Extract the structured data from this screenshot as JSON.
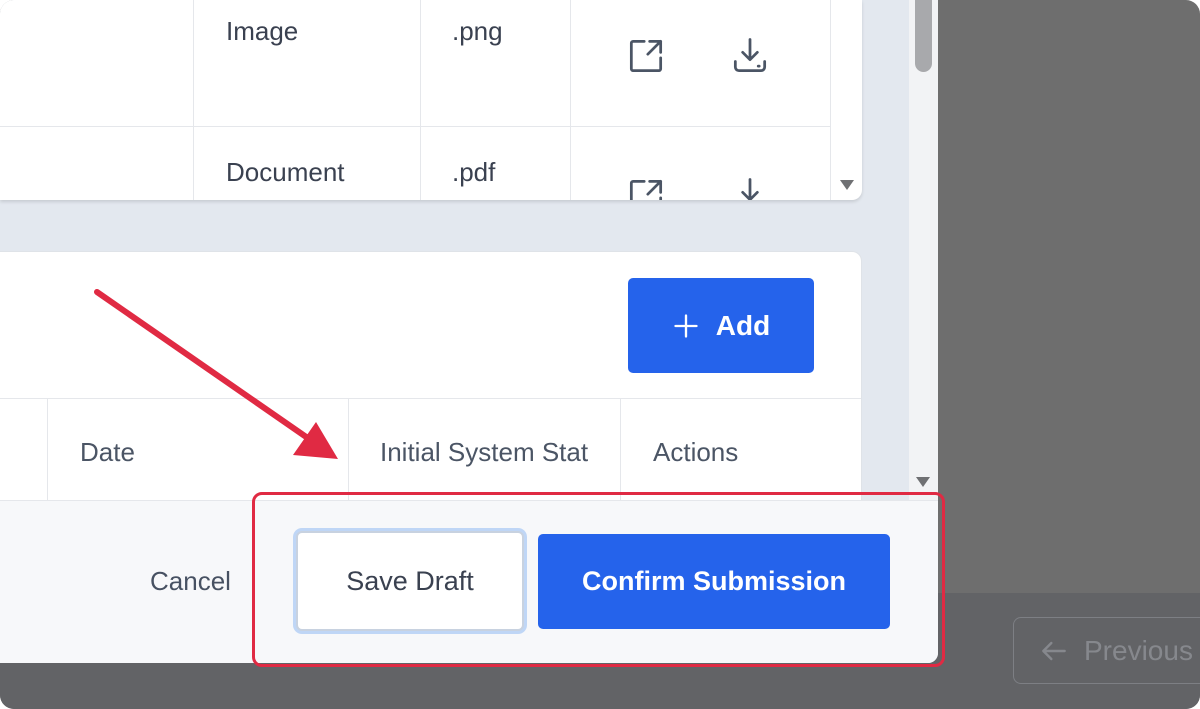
{
  "files_table": {
    "rows": [
      {
        "type": "Image",
        "extension": ".png",
        "actions": [
          "external-link-icon",
          "download-icon"
        ]
      },
      {
        "type": "Document",
        "extension": ".pdf",
        "actions": [
          "external-link-icon",
          "download-icon"
        ]
      }
    ]
  },
  "records_section": {
    "add_button_label": "Add",
    "columns": [
      "Date",
      "Initial System Stat",
      "Actions"
    ]
  },
  "footer": {
    "cancel_label": "Cancel",
    "save_draft_label": "Save Draft",
    "confirm_label": "Confirm Submission"
  },
  "background_pager": {
    "previous_label": "Previous"
  },
  "annotation": {
    "arrow_color": "#e02a43",
    "highlight_color": "#e02a43"
  },
  "colors": {
    "primary": "#2563eb",
    "overlay": "#6e6e6e"
  }
}
